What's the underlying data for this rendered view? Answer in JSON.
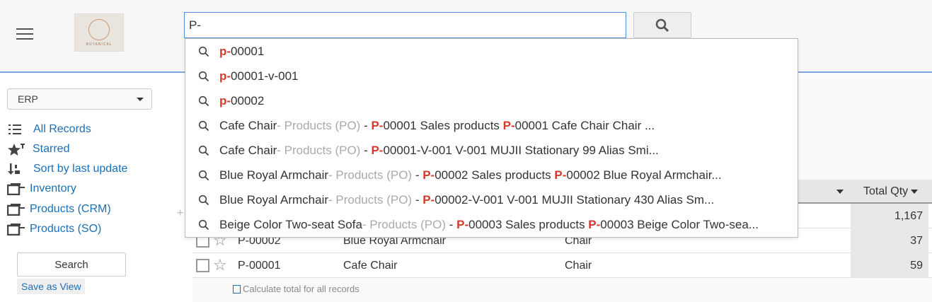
{
  "search": {
    "value": "P-"
  },
  "logo": {
    "text": "BOTANICAL"
  },
  "sidebar": {
    "app_select": "ERP",
    "items": [
      {
        "label": "All Records",
        "icon": "list-icon"
      },
      {
        "label": "Starred",
        "icon": "star-filter-icon"
      },
      {
        "label": "Sort by last update",
        "icon": "sort-icon"
      },
      {
        "label": "Inventory",
        "icon": "folder-icon"
      },
      {
        "label": "Products (CRM)",
        "icon": "folder-icon"
      },
      {
        "label": "Products (SO)",
        "icon": "folder-icon"
      }
    ],
    "search_button": "Search",
    "save_view": "Save as View"
  },
  "suggestions": [
    {
      "hl": "p-",
      "rest": "00001"
    },
    {
      "hl": "p-",
      "rest": "00001-v-001"
    },
    {
      "hl": "p-",
      "rest": "00002"
    },
    {
      "name": "Cafe Chair",
      "source": " - Products (PO)",
      "sep": " - ",
      "p1": "P-",
      "t1": "00001 Sales products ",
      "p2": "P-",
      "t2": "00001 Cafe Chair Chair ..."
    },
    {
      "name": "Cafe Chair",
      "source": " - Products (PO)",
      "sep": " - ",
      "p1": "P-",
      "t1": "00001-V-001 V-001 MUJII Stationary 99 Alias Smi...",
      "p2": "",
      "t2": ""
    },
    {
      "name": "Blue Royal Armchair",
      "source": " - Products (PO)",
      "sep": " - ",
      "p1": "P-",
      "t1": "00002 Sales products ",
      "p2": "P-",
      "t2": "00002 Blue Royal Armchair..."
    },
    {
      "name": "Blue Royal Armchair",
      "source": " - Products (PO)",
      "sep": " - ",
      "p1": "P-",
      "t1": "00002-V-001 V-001 MUJII Stationary 430 Alias Sm...",
      "p2": "",
      "t2": ""
    },
    {
      "name": "Beige Color Two-seat Sofa",
      "source": " - Products (PO)",
      "sep": " - ",
      "p1": "P-",
      "t1": "00003 Sales products ",
      "p2": "P-",
      "t2": "00003 Beige Color Two-sea..."
    }
  ],
  "table": {
    "qty_header": "Total Qty",
    "rows": [
      {
        "id": "",
        "name": "",
        "category": "",
        "qty": "1,167"
      },
      {
        "id": "P-00002",
        "name": "Blue Royal Armchair",
        "category": "Chair",
        "qty": "37"
      },
      {
        "id": "P-00001",
        "name": "Cafe Chair",
        "category": "Chair",
        "qty": "59"
      }
    ],
    "calc_label": "Calculate total for all records"
  }
}
